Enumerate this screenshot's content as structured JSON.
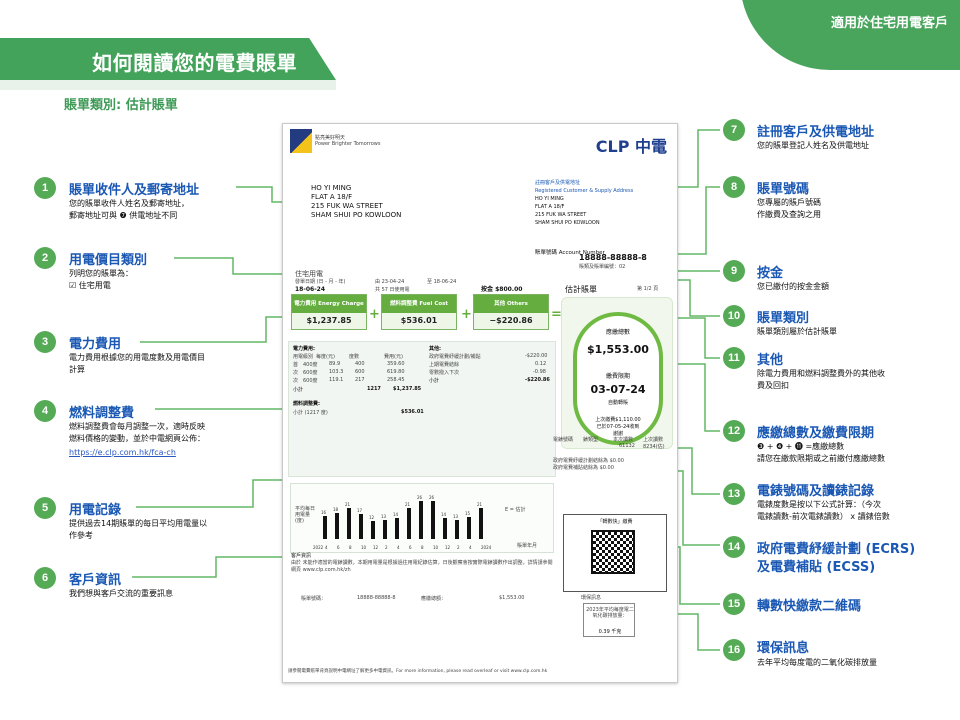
{
  "header": {
    "title": "如何閱讀您的電費賬單",
    "badge": "適用於住宅用電客戶",
    "bill_type": "賬單類別: 估計賬單"
  },
  "bill": {
    "brand_tagline": "點亮美好明天",
    "brand_en": "Power Brighter Tomorrows",
    "logo_text": "CLP 中電",
    "customer_lines": [
      "HO YI MING",
      "FLAT A 18/F",
      "215 FUK WA STREET",
      "SHAM SHUI PO KOWLOON"
    ],
    "registered_title": "註冊客戶及供電地址",
    "registered_title_en": "Registered Customer & Supply Address",
    "registered_lines": [
      "HO YI MING",
      "FLAT A 18/F",
      "215 FUK WA STREET",
      "SHAM SHUI PO KOWLOON"
    ],
    "account_label": "賬單號碼 Account Number",
    "account_number": "18888-88888-8",
    "bill_type_small": "賬類及賬單編號：02",
    "tariff_label": "住宅用電",
    "bill_date_label": "發單日期 (日 - 月 - 年)",
    "bill_date": "18-06-24",
    "period_from": "由 23-04-24",
    "period_to": "至 18-06-24",
    "period_days": "共 57 日使用電",
    "deposit": "按金 $800.00",
    "page": "第 1/2 頁",
    "estimated_label": "估計賬單",
    "energy_charge_title": "電力費用 Energy Charge",
    "energy_charge": "$1,237.85",
    "fuel_charge_title": "燃料調整費 Fuel Cost Adjustment",
    "fuel_charge": "$536.01",
    "others_title": "其他 Others",
    "others_charge": "−$220.86",
    "total_label": "應繳總數",
    "total": "$1,553.00",
    "due_label": "繳費限期",
    "due_date": "03-07-24",
    "due_note": "自動轉賬",
    "last_payment": "上次繳費$1,110.00",
    "last_payment_date": "已於07-05-24收到",
    "thanks": "謝謝",
    "energy_table_title": "電力費用:",
    "energy_table_header": [
      "用電級別",
      "每度(元)",
      "度數",
      "費用(元)"
    ],
    "energy_rows": [
      [
        "首",
        "400度",
        "89.9",
        "400",
        "359.60"
      ],
      [
        "次",
        "600度",
        "103.3",
        "600",
        "619.80"
      ],
      [
        "次",
        "600度",
        "119.1",
        "217",
        "258.45"
      ]
    ],
    "energy_subtotal": [
      "小計",
      "1217",
      "$1,237.85"
    ],
    "others_table_title": "其他:",
    "others_rows": [
      [
        "政府電費紓緩計劃/補貼",
        "-$220.00"
      ],
      [
        "上期電費結餘",
        "0.12"
      ],
      [
        "零數撥入下次",
        "-0.98"
      ]
    ],
    "others_subtotal": [
      "小計",
      "-$220.86"
    ],
    "fuel_table_title": "燃料調整費:",
    "fuel_row": [
      "小計 (1217 度)",
      "$536.01"
    ],
    "meter_labels": [
      "電錶號碼",
      "錶類型",
      "本次讀數",
      "上次讀數"
    ],
    "meter_values": [
      "",
      "",
      "61132",
      "8234(估)"
    ],
    "ecrs_lines": [
      "政府電費紓緩計劃結餘為  $0.00",
      "政府電費補貼結餘為  $0.00"
    ],
    "chart_title": "平均每日用電量(度)",
    "chart_values": [
      16,
      18,
      21,
      17,
      12,
      13,
      14,
      21,
      26,
      26,
      14,
      13,
      15,
      21
    ],
    "chart_labels": [
      "2022",
      "4",
      "6",
      "8",
      "10",
      "12",
      "2",
      "4",
      "6",
      "8",
      "10",
      "12",
      "2",
      "4",
      "2024"
    ],
    "chart_legend": "E = 估計",
    "chart_axis_unit": "賬單年月",
    "cs_title": "客戶資訊",
    "cs_text": "由於 未能作適當的電錶讀數，本期用電量是根據過往用電紀錄估算，日後觀察會按實際電錶讀數作出調整，詳情請參閱網頁 www.clp.com.hk/zh",
    "qr_title": "「轉數快」繳費",
    "stub_account_label": "賬單號碼：",
    "stub_account": "18888-88888-8",
    "stub_amount_label": "應繳總額：",
    "stub_amount": "$1,553.00",
    "stub_env_title": "環保訊息",
    "env_label": "2023年平均每度電二氧化碳排放量：",
    "env_value": "0.39 千克",
    "footer": "請參閱電費賬單背頁說明中電網址了解更多中電資訊。For more information, please read overleaf or visit www.clp.com.hk"
  },
  "callouts": [
    {
      "num": "1",
      "title": "賬單收件人及郵寄地址",
      "desc": [
        "您的賬單收件人姓名及郵寄地址，",
        "郵寄地址可與 ❼ 供電地址不同"
      ]
    },
    {
      "num": "2",
      "title": "用電價目類別",
      "desc": [
        "列明您的賬單為：",
        "☑ 住宅用電"
      ]
    },
    {
      "num": "3",
      "title": "電力費用",
      "desc": [
        "電力費用根據您的用電度數及用電價目",
        "計算"
      ]
    },
    {
      "num": "4",
      "title": "燃料調整費",
      "desc": [
        "燃料調整費會每月調整一次，適時反映",
        "燃料價格的變動，並於中電網頁公佈："
      ],
      "link": "https://e.clp.com.hk/fca-ch"
    },
    {
      "num": "5",
      "title": "用電記錄",
      "desc": [
        "提供過去14期賬單的每日平均用電量以",
        "作參考"
      ]
    },
    {
      "num": "6",
      "title": "客戶資訊",
      "desc": [
        "我們想與客戶交流的重要訊息"
      ]
    },
    {
      "num": "7",
      "title": "註冊客戶及供電地址",
      "desc": [
        "您的賬單登記人姓名及供電地址"
      ]
    },
    {
      "num": "8",
      "title": "賬單號碼",
      "desc": [
        "您專屬的賬戶號碼",
        "作繳費及查詢之用"
      ]
    },
    {
      "num": "9",
      "title": "按金",
      "desc": [
        "您已繳付的按金金額"
      ]
    },
    {
      "num": "10",
      "title": "賬單類別",
      "desc": [
        "賬單類別屬於估計賬單"
      ]
    },
    {
      "num": "11",
      "title": "其他",
      "desc": [
        "除電力費用和燃料調整費外的其他收",
        "費及回扣"
      ]
    },
    {
      "num": "12",
      "title": "應繳總數及繳費限期",
      "desc": [
        "❸ + ❹ + ⓫ =應繳總數",
        "請您在繳款限期或之前繳付應繳總數"
      ]
    },
    {
      "num": "13",
      "title": "電錶號碼及讀錶記錄",
      "desc": [
        "電錶度數是按以下公式計算：（今次",
        "電錶讀數-前次電錶讀數） x 讀錶倍數"
      ]
    },
    {
      "num": "14",
      "title": "政府電費紓緩計劃 (ECRS)",
      "title2": "及電費補貼 (ECSS)",
      "desc": []
    },
    {
      "num": "15",
      "title": "轉數快繳款二維碼",
      "desc": []
    },
    {
      "num": "16",
      "title": "環保訊息",
      "desc": [
        "去年平均每度電的二氧化碳排放量"
      ]
    }
  ]
}
